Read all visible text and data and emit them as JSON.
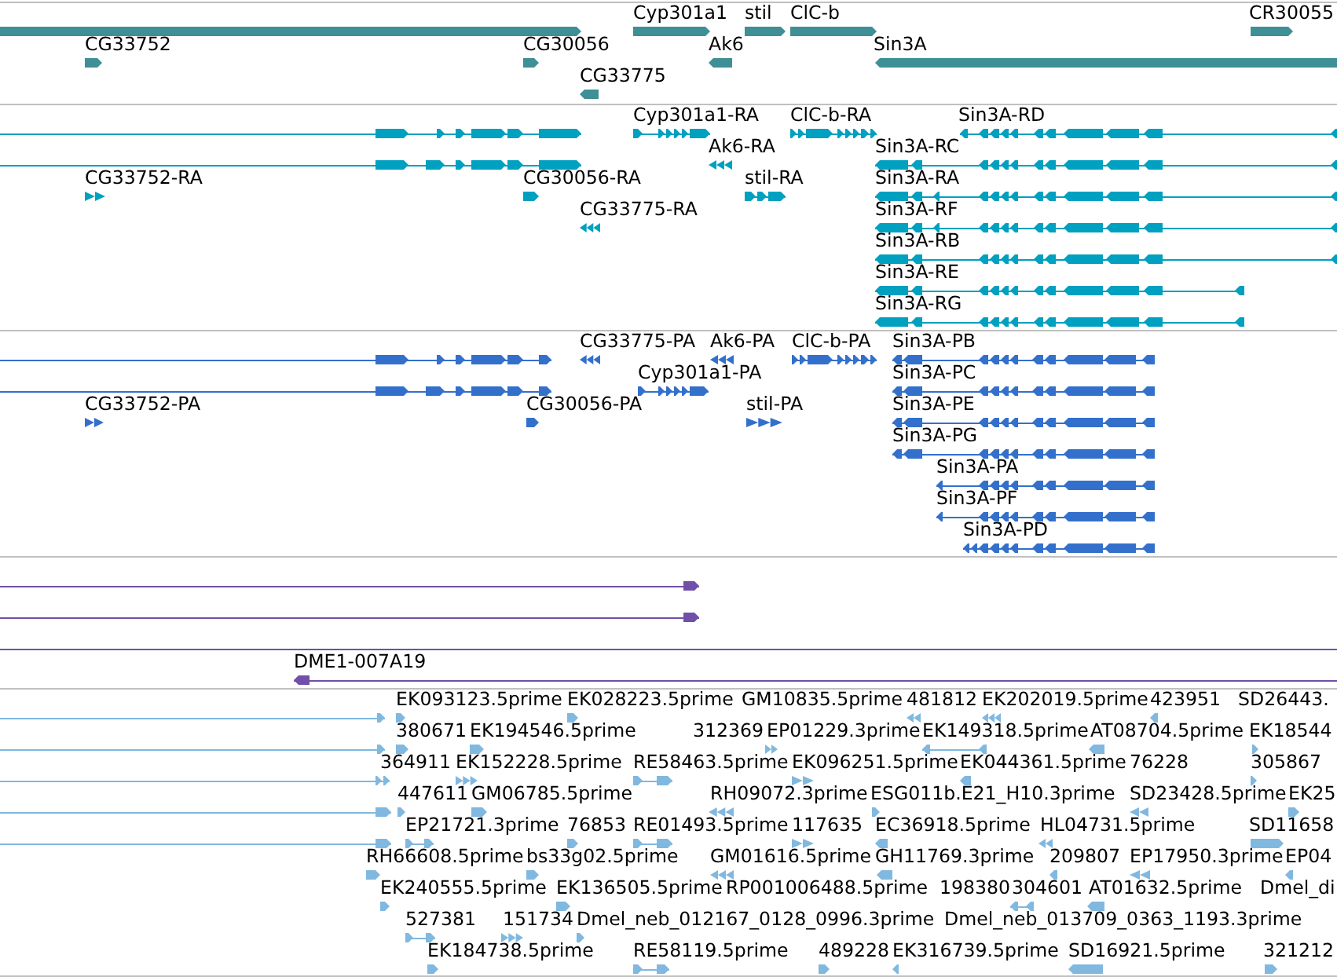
{
  "tracks": [
    {
      "kind": "gene",
      "features": [
        {
          "reverse": false
        },
        {
          "label": "Cyp301a1",
          "reverse": false
        },
        {
          "label": "stil",
          "reverse": false
        },
        {
          "label": "ClC-b",
          "reverse": false
        },
        {
          "label": "CR30055",
          "reverse": false
        },
        {
          "label": "CG33752",
          "reverse": false
        },
        {
          "label": "CG30056",
          "reverse": false
        },
        {
          "label": "Ak6",
          "reverse": true
        },
        {
          "label": "Sin3A",
          "reverse": true
        },
        {
          "label": "CG33775",
          "reverse": true
        }
      ]
    },
    {
      "kind": "transcript",
      "features": [
        {
          "reverse": false
        },
        {
          "label": "Cyp301a1-RA",
          "reverse": false
        },
        {
          "label": "ClC-b-RA",
          "reverse": false
        },
        {
          "label": "Sin3A-RD",
          "reverse": true
        },
        {
          "reverse": false
        },
        {
          "label": "Ak6-RA",
          "reverse": true
        },
        {
          "label": "Sin3A-RC",
          "reverse": true
        },
        {
          "label": "CG33752-RA",
          "reverse": false
        },
        {
          "label": "CG30056-RA",
          "reverse": false
        },
        {
          "label": "stil-RA",
          "reverse": false
        },
        {
          "label": "Sin3A-RA",
          "reverse": true
        },
        {
          "label": "CG33775-RA",
          "reverse": true
        },
        {
          "label": "Sin3A-RF",
          "reverse": true
        },
        {
          "label": "Sin3A-RB",
          "reverse": true
        },
        {
          "label": "Sin3A-RE",
          "reverse": true
        },
        {
          "label": "Sin3A-RG",
          "reverse": true
        }
      ]
    },
    {
      "kind": "protein",
      "features": [
        {
          "reverse": false
        },
        {
          "label": "CG33775-PA",
          "reverse": true
        },
        {
          "label": "Ak6-PA",
          "reverse": true
        },
        {
          "label": "ClC-b-PA",
          "reverse": false
        },
        {
          "label": "Sin3A-PB",
          "reverse": true
        },
        {
          "reverse": false
        },
        {
          "label": "Cyp301a1-PA",
          "reverse": false
        },
        {
          "label": "Sin3A-PC",
          "reverse": true
        },
        {
          "label": "CG33752-PA",
          "reverse": false
        },
        {
          "label": "CG30056-PA",
          "reverse": false
        },
        {
          "label": "stil-PA",
          "reverse": false
        },
        {
          "label": "Sin3A-PE",
          "reverse": true
        },
        {
          "label": "Sin3A-PG",
          "reverse": true
        },
        {
          "label": "Sin3A-PA",
          "reverse": true
        },
        {
          "label": "Sin3A-PF",
          "reverse": true
        },
        {
          "label": "Sin3A-PD",
          "reverse": true
        }
      ]
    },
    {
      "kind": "clone",
      "features": [
        {
          "kind": "arrow",
          "reverse": false
        },
        {
          "kind": "arrow",
          "reverse": false
        },
        {
          "kind": "line"
        },
        {
          "kind": "arrow",
          "label": "DME1-007A19",
          "reverse": true
        }
      ]
    },
    {
      "kind": "est",
      "features": [
        {
          "reverse": false
        },
        {
          "label": "EK093123.5prime",
          "reverse": false
        },
        {
          "label": "EK028223.5prime",
          "reverse": false
        },
        {
          "label": "GM10835.5prime"
        },
        {
          "label": "481812",
          "reverse": true
        },
        {
          "label": "EK202019.5prime",
          "reverse": true
        },
        {
          "label": "423951",
          "reverse": true
        },
        {
          "label": "SD26443."
        },
        {
          "reverse": false
        },
        {
          "label": "380671",
          "reverse": false
        },
        {
          "label": "EK194546.5prime",
          "reverse": false
        },
        {
          "label": "312369"
        },
        {
          "label": "EP01229.3prime",
          "reverse": false
        },
        {
          "label": "EK149318.5prime",
          "reverse": true
        },
        {
          "label": "AT08704.5prime",
          "reverse": true
        },
        {
          "label": "EK18544",
          "reverse": false
        },
        {
          "reverse": false
        },
        {
          "label": "364911"
        },
        {
          "label": "EK152228.5prime",
          "reverse": false
        },
        {
          "label": "RE58463.5prime",
          "reverse": false
        },
        {
          "label": "EK096251.5prime",
          "reverse": false
        },
        {
          "label": "EK044361.5prime",
          "reverse": true
        },
        {
          "label": "76228"
        },
        {
          "label": "305867",
          "reverse": false
        },
        {
          "reverse": false
        },
        {
          "label": "447611",
          "reverse": false
        },
        {
          "label": "GM06785.5prime",
          "reverse": false
        },
        {
          "label": "RH09072.3prime",
          "reverse": true
        },
        {
          "label": "ESG011b.E21_H10.3prime",
          "reverse": false
        },
        {
          "label": "SD23428.5prime",
          "reverse": true
        },
        {
          "label": "EK25",
          "reverse": false
        },
        {
          "reverse": false
        },
        {
          "label": "EP21721.3prime",
          "reverse": false
        },
        {
          "label": "76853",
          "reverse": false
        },
        {
          "label": "RE01493.5prime",
          "reverse": false
        },
        {
          "label": "117635",
          "reverse": false
        },
        {
          "label": "EC36918.5prime",
          "reverse": true
        },
        {
          "label": "HL04731.5prime",
          "reverse": true
        },
        {
          "label": "SD11658",
          "reverse": false
        },
        {
          "label": "RH66608.5prime",
          "reverse": false
        },
        {
          "label": "bs33g02.5prime",
          "reverse": false
        },
        {
          "label": "GM01616.5prime",
          "reverse": true
        },
        {
          "label": "GH11769.3prime",
          "reverse": true
        },
        {
          "label": "209807",
          "reverse": true
        },
        {
          "label": "EP17950.3prime",
          "reverse": true
        },
        {
          "label": "EP04",
          "reverse": true
        },
        {
          "label": "EK240555.5prime",
          "reverse": false
        },
        {
          "label": "EK136505.5prime",
          "reverse": false
        },
        {
          "label": "RP001006488.5prime"
        },
        {
          "label": "198380"
        },
        {
          "label": "304601",
          "reverse": true
        },
        {
          "label": "AT01632.5prime",
          "reverse": true
        },
        {
          "label": "Dmel_di"
        },
        {
          "label": "527381",
          "reverse": false
        },
        {
          "label": "151734",
          "reverse": false
        },
        {
          "label": "Dmel_neb_012167_0128_0996.3prime",
          "reverse": false
        },
        {
          "label": "Dmel_neb_013709_0363_1193.3prime"
        },
        {
          "label": "EK184738.5prime",
          "reverse": false
        },
        {
          "label": "RE58119.5prime",
          "reverse": false
        },
        {
          "label": "489228",
          "reverse": false
        },
        {
          "label": "EK316739.5prime",
          "reverse": true
        },
        {
          "label": "SD16921.5prime",
          "reverse": true
        },
        {
          "label": "321212",
          "reverse": false
        }
      ]
    }
  ]
}
